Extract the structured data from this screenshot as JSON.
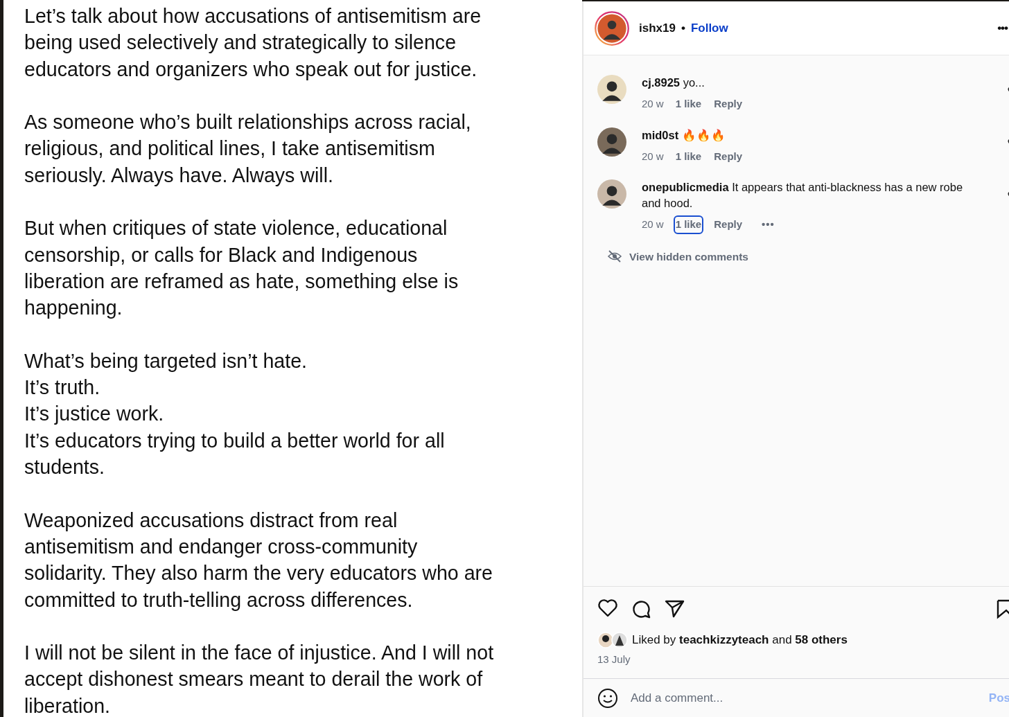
{
  "post_text": [
    [
      "Let’s talk about how accusations of antisemitism are",
      "being used selectively and strategically to silence",
      "educators and organizers who speak out for justice."
    ],
    [
      "As someone who’s built relationships across racial,",
      "religious, and political lines, I take antisemitism",
      "seriously. Always have. Always will."
    ],
    [
      "But when critiques of state violence, educational",
      "censorship, or calls for Black and Indigenous",
      "liberation are reframed as hate, something else is",
      "happening."
    ],
    [
      "What’s being targeted isn’t hate.",
      "It’s truth.",
      "It’s justice work.",
      "It’s educators trying to build a better world for all",
      "students."
    ],
    [
      "Weaponized accusations distract from real",
      "antisemitism and endanger cross-community",
      "solidarity. They also harm the very educators who are",
      "committed to truth-telling across differences."
    ],
    [
      "I will not be silent in the face of injustice. And I will not",
      "accept dishonest smears meant to derail the work of",
      "liberation."
    ]
  ],
  "header": {
    "username": "ishx19",
    "separator": "•",
    "follow": "Follow",
    "more": "•••"
  },
  "comments": [
    {
      "username": "cj.8925",
      "text": "yo...",
      "time": "20 w",
      "likes": "1 like",
      "likes_focused": false,
      "reply": "Reply"
    },
    {
      "username": "mid0st",
      "text": "🔥🔥🔥",
      "time": "20 w",
      "likes": "1 like",
      "likes_focused": false,
      "reply": "Reply"
    },
    {
      "username": "onepublicmedia",
      "text": "It appears that anti-blackness has a new robe and hood.",
      "time": "20 w",
      "likes": "1 like",
      "likes_focused": true,
      "reply": "Reply",
      "more": "•••"
    }
  ],
  "hidden_comments": "View hidden comments",
  "liked_by": "Liked by **teachkizzyteach** and **58 others**",
  "date": "13 July",
  "comment_box": {
    "placeholder": "Add a comment...",
    "post": "Pos"
  }
}
